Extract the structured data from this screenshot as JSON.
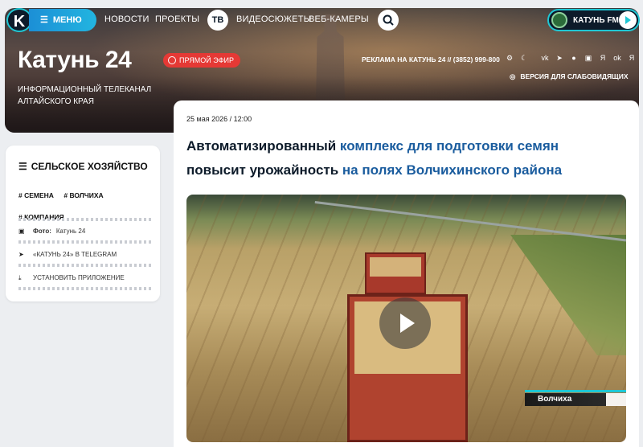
{
  "header": {
    "logo_letter": "K",
    "menu_label": "МЕНЮ",
    "nav": {
      "news": "НОВОСТИ",
      "projects": "ПРОЕКТЫ",
      "tv": "ТВ",
      "videos": "ВИДЕОСЮЖЕТЫ",
      "webcams": "ВЕБ-КАМЕРЫ"
    },
    "fm_label": "КАТУНЬ FM",
    "brand": "Катунь 24",
    "live_label": "ПРЯМОЙ ЭФИР",
    "tagline": "ИНФОРМАЦИОННЫЙ ТЕЛЕКАНАЛ АЛТАЙСКОГО КРАЯ",
    "ad_line": "РЕКЛАМА НА КАТУНЬ 24 // (3852) 999-800",
    "social_icons": [
      "settings-icon",
      "moon-icon",
      "vk-icon",
      "telegram-icon",
      "chat-icon",
      "max-icon",
      "yandex-icon",
      "ok-icon",
      "ya-icon"
    ],
    "social_glyphs": [
      "⚙",
      "☾",
      "vk",
      "➤",
      "●",
      "▣",
      "Я",
      "ok",
      "Я"
    ],
    "a11y_label": "ВЕРСИЯ ДЛЯ СЛАБОВИДЯЩИХ"
  },
  "sidebar": {
    "category": "СЕЛЬСКОЕ ХОЗЯЙСТВО",
    "tags": [
      "# СЕМЕНА",
      "# ВОЛЧИХА",
      "# КОМПАНИЯ"
    ],
    "photo_label": "Фото:",
    "photo_value": "Катунь 24",
    "telegram_label": "«КАТУНЬ 24» В TELEGRAM",
    "install_label": "УСТАНОВИТЬ ПРИЛОЖЕНИЕ"
  },
  "article": {
    "date": "25 мая 2026 / 12:00",
    "headline_part1": "Автоматизированный",
    "headline_part2": " комплекс ",
    "headline_part3": "для подготовки семян",
    "headline_part4": "повысит урожайность ",
    "headline_part5": "на полях Волчихинского района",
    "video_location": "Волчиха"
  },
  "colors": {
    "accent": "#1fc7d4",
    "menu_blue": "#1c8fd6",
    "live_red": "#e53935",
    "headline_dark": "#0d1b2a",
    "headline_blue": "#1a5c9e"
  }
}
